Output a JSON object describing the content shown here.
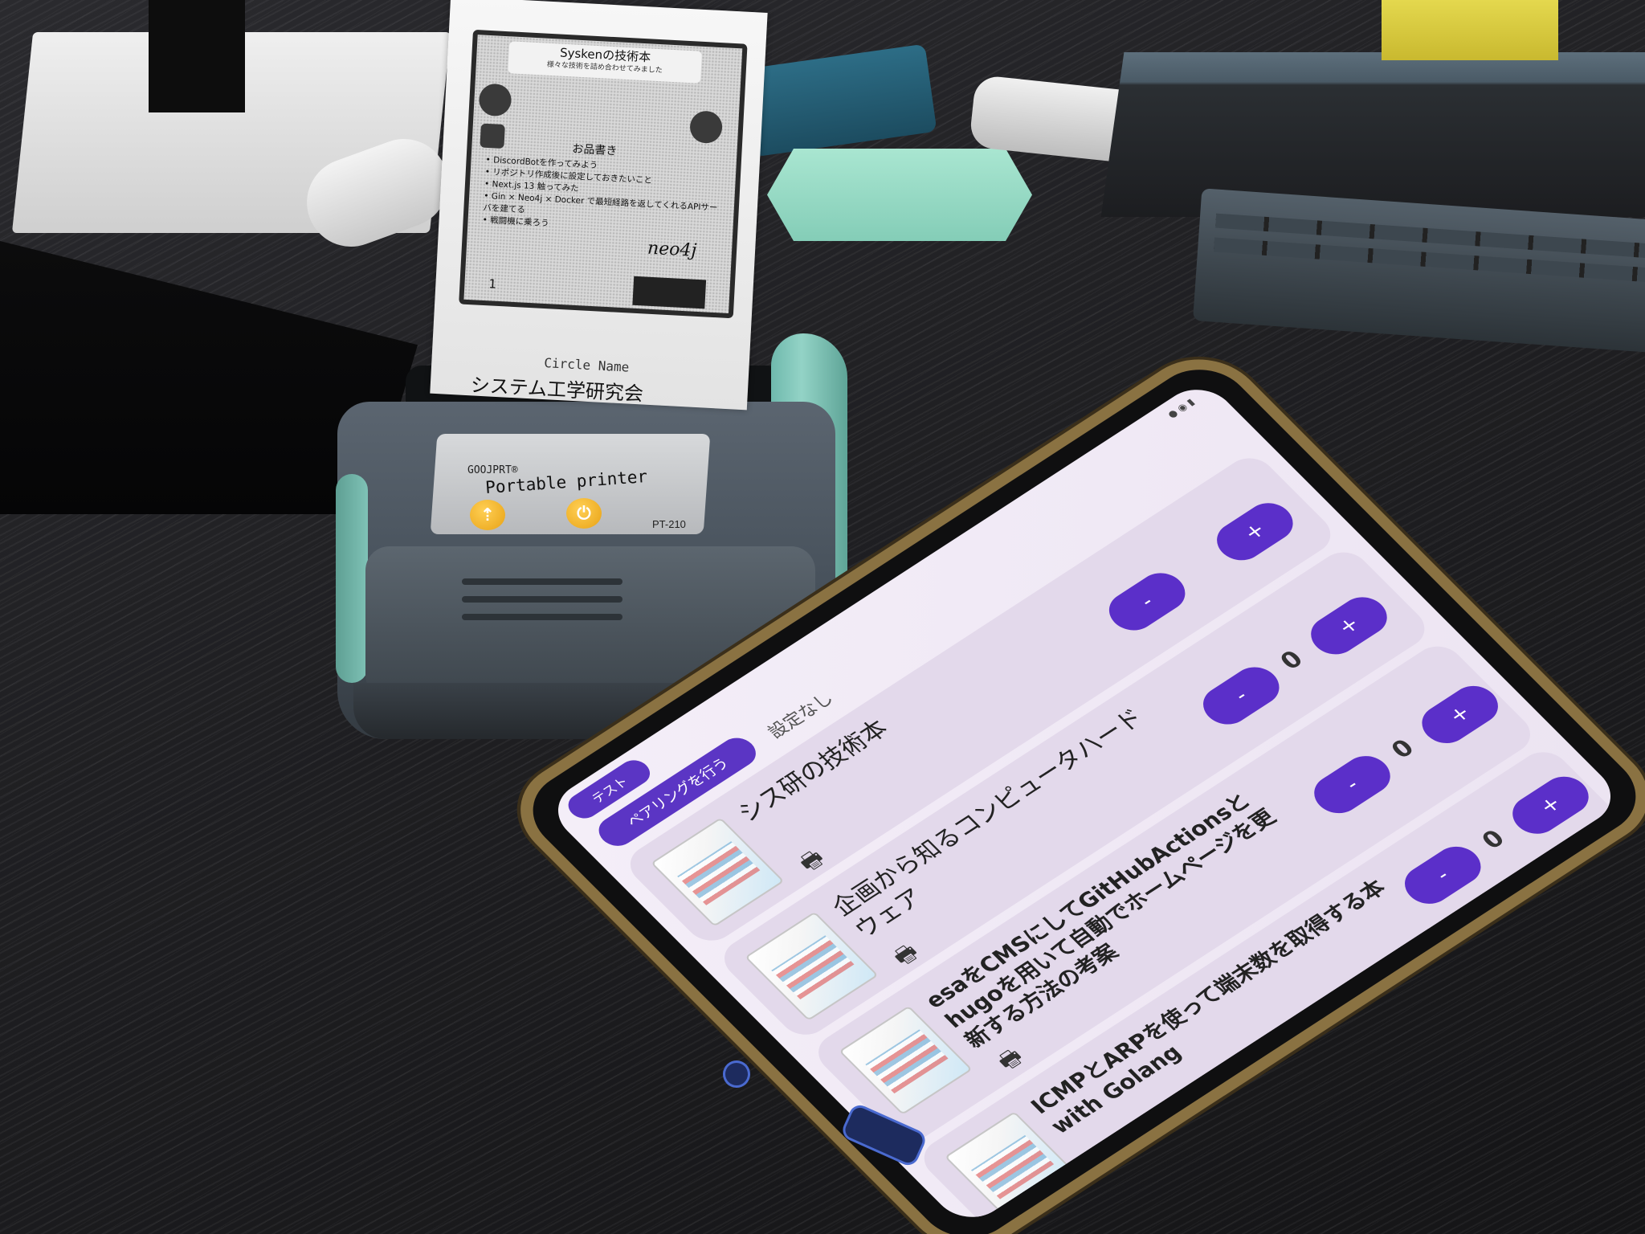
{
  "receipt": {
    "title": "Syskenの技術本",
    "subtitle": "様々な技術を詰め合わせてみました",
    "heading": "お品書き",
    "items": [
      "DiscordBotを作ってみよう",
      "リポジトリ作成後に設定しておきたいこと",
      "Next.js 13 触ってみた",
      "Gin × Neo4j × Docker で最短経路を返してくれるAPIサーバを建てる",
      "戦闘機に乗ろう"
    ],
    "logo_text": "neo4j",
    "page_number": "1",
    "circle_label": "Circle Name",
    "circle_name": "システム工学研究会"
  },
  "printer": {
    "brand": "GOOJPRT®",
    "model_label": "Portable printer",
    "model_number": "PT-210",
    "accent_color": "#f2b21b",
    "body_color": "#4b555f",
    "trim_color": "#86c8bb"
  },
  "phone_app": {
    "test_button": "テスト",
    "pair_button": "ペアリングを行う",
    "status": "設定なし",
    "minus_label": "-",
    "plus_label": "+",
    "print_icon": "printer-icon",
    "accent_color": "#5b2fc9",
    "books": [
      {
        "title": "シス研の技術本",
        "quantity": ""
      },
      {
        "title": "企画から知るコンピュータハードウェア",
        "quantity": "0"
      },
      {
        "title": "esaをCMSにしてGitHubActionsとhugoを用いて自動でホームページを更新する方法の考案",
        "quantity": "0"
      },
      {
        "title": "ICMPとARPを使って端末数を取得する本 with Golang",
        "quantity": "0"
      }
    ]
  }
}
